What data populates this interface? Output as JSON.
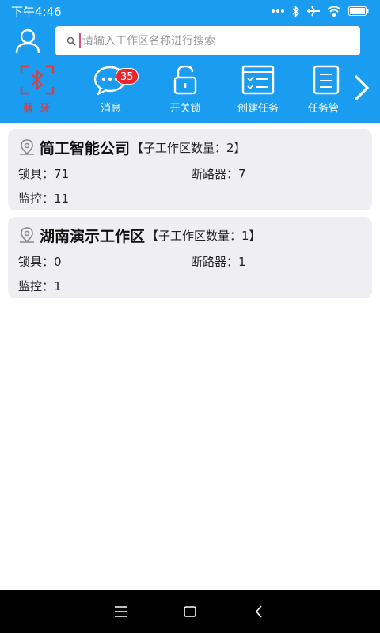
{
  "status_bar": {
    "time": "下午4:46",
    "icons": [
      "more-dots-icon",
      "bluetooth-icon",
      "airplane-icon",
      "wifi-icon",
      "battery-icon"
    ]
  },
  "search": {
    "placeholder": "请输入工作区名称进行搜索",
    "value": ""
  },
  "toolbar": {
    "items": [
      {
        "label": "蓝 牙",
        "icon": "bluetooth-scan-icon"
      },
      {
        "label": "消息",
        "icon": "message-icon",
        "badge": "35"
      },
      {
        "label": "开关锁",
        "icon": "lock-icon"
      },
      {
        "label": "创建任务",
        "icon": "task-checklist-icon"
      },
      {
        "label": "任务管",
        "icon": "task-list-icon"
      }
    ],
    "next_icon": "chevron-right-icon"
  },
  "workspaces": [
    {
      "name": "简工智能公司",
      "count_label": "【子工作区数量：2】",
      "lock": "锁具：71",
      "breaker": "断路器：7",
      "monitor": "监控：11"
    },
    {
      "name": "湖南演示工作区",
      "count_label": "【子工作区数量：1】",
      "lock": "锁具：0",
      "breaker": "断路器：1",
      "monitor": "监控：1"
    }
  ],
  "colors": {
    "primary": "#1a9cf0",
    "badge": "#e8262e",
    "bluetooth_accent": "#e23a3a",
    "card_bg": "#efeff3"
  }
}
